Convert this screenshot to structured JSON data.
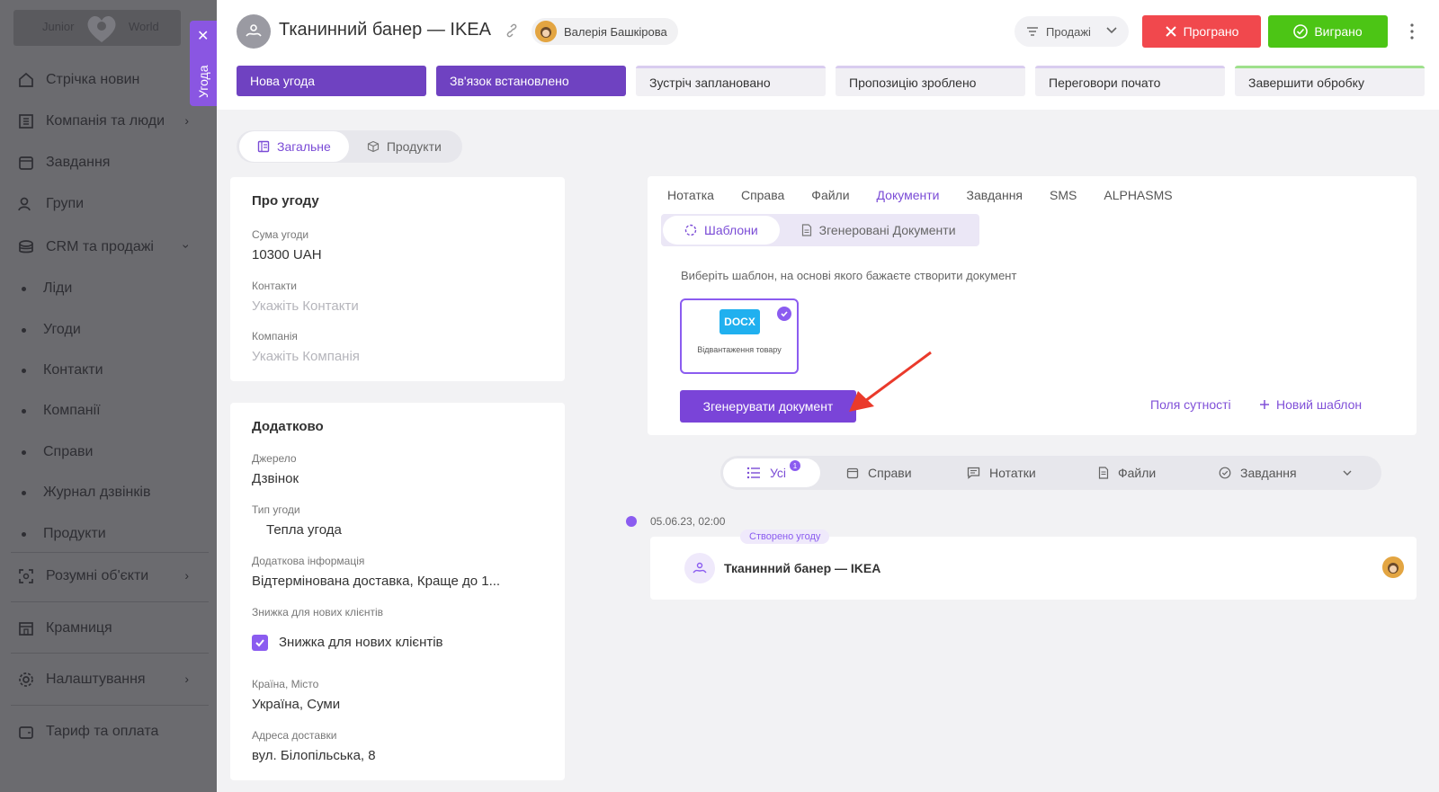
{
  "sidebar": {
    "logo_left": "Junior",
    "logo_right": "World",
    "items": [
      {
        "label": "Стрічка новин"
      },
      {
        "label": "Компанія та люди"
      },
      {
        "label": "Завдання"
      },
      {
        "label": "Групи"
      },
      {
        "label": "CRM та продажі"
      },
      {
        "label": "Ліди"
      },
      {
        "label": "Угоди"
      },
      {
        "label": "Контакти"
      },
      {
        "label": "Компанії"
      },
      {
        "label": "Справи"
      },
      {
        "label": "Журнал дзвінків"
      },
      {
        "label": "Продукти"
      },
      {
        "label": "Розумні об'єкти"
      },
      {
        "label": "Крамниця"
      },
      {
        "label": "Налаштування"
      },
      {
        "label": "Тариф та оплата"
      }
    ]
  },
  "side_tab": {
    "label": "Угода"
  },
  "header": {
    "title": "Тканинний банер — IKEA",
    "owner": "Валерія Башкірова",
    "pipeline": "Продажі",
    "lost_label": "Програно",
    "won_label": "Виграно"
  },
  "stages": [
    {
      "label": "Нова угода"
    },
    {
      "label": "Зв'язок встановлено"
    },
    {
      "label": "Зустріч заплановано"
    },
    {
      "label": "Пропозицію зроблено"
    },
    {
      "label": "Переговори почато"
    },
    {
      "label": "Завершити обробку"
    }
  ],
  "view_tabs": {
    "general": "Загальне",
    "products": "Продукти"
  },
  "about": {
    "heading": "Про угоду",
    "amount_label": "Сума угоди",
    "amount_value": "10300 UAH",
    "contacts_label": "Контакти",
    "contacts_placeholder": "Укажіть Контакти",
    "company_label": "Компанія",
    "company_placeholder": "Укажіть Компанія"
  },
  "extra": {
    "heading": "Додатково",
    "source_label": "Джерело",
    "source_value": "Дзвінок",
    "type_label": "Тип угоди",
    "type_value": "Тепла угода",
    "info_label": "Додаткова інформація",
    "info_value": "Відтермінована доставка, Краще до 1...",
    "discount_label": "Знижка для нових клієнтів",
    "discount_checkbox_label": "Знижка для нових клієнтів",
    "location_label": "Країна, Місто",
    "location_value": "Україна, Суми",
    "address_label": "Адреса доставки",
    "address_value": "вул. Білопільська, 8"
  },
  "documents": {
    "tabs": [
      {
        "label": "Нотатка"
      },
      {
        "label": "Справа"
      },
      {
        "label": "Файли"
      },
      {
        "label": "Документи"
      },
      {
        "label": "Завдання"
      },
      {
        "label": "SMS"
      },
      {
        "label": "ALPHASMS"
      }
    ],
    "sub_templates": "Шаблони",
    "sub_generated": "Згенеровані Документи",
    "hint": "Виберіть шаблон, на основі якого бажаєте створити документ",
    "template_badge": "DOCX",
    "template_name": "Відвантаження товару",
    "generate_button": "Згенерувати документ",
    "entity_fields_link": "Поля сутності",
    "new_template_link": "Новий шаблон"
  },
  "filter": {
    "all": "Усі",
    "all_count": "1",
    "deals": "Справи",
    "notes": "Нотатки",
    "files": "Файли",
    "tasks": "Завдання"
  },
  "timeline": {
    "date": "05.06.23, 02:00",
    "tag": "Створено угоду",
    "title": "Тканинний банер — IKEA"
  },
  "colors": {
    "accent": "#7a44d8",
    "lost": "#f1484d",
    "won": "#4cc515",
    "docx": "#20b0ef"
  }
}
